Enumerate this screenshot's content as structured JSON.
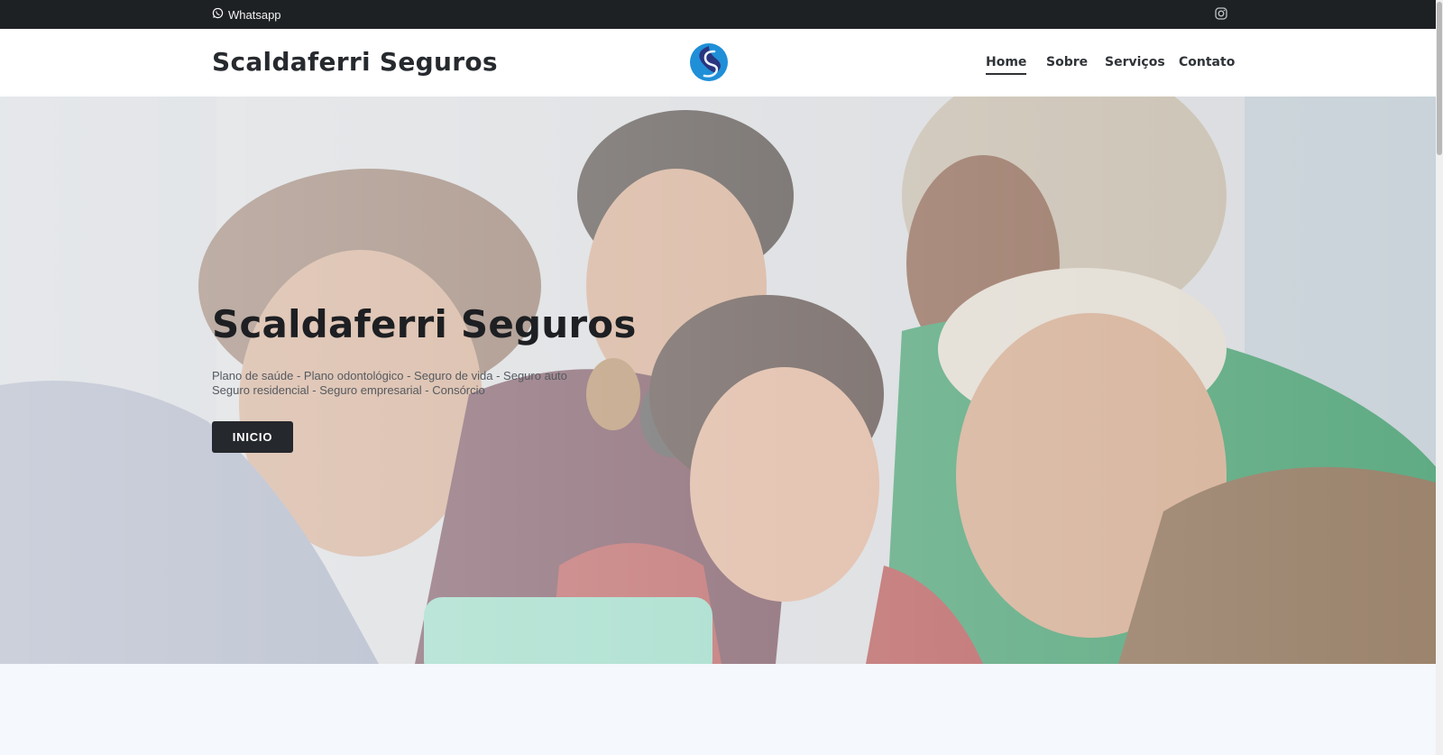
{
  "topbar": {
    "whatsapp_label": "Whatsapp",
    "whatsapp_icon": "whatsapp-icon",
    "instagram_icon": "instagram-icon"
  },
  "header": {
    "brand": "Scaldaferri Seguros",
    "logo_icon": "scaldaferri-logo",
    "nav": [
      {
        "label": "Home",
        "active": true
      },
      {
        "label": "Sobre",
        "active": false
      },
      {
        "label": "Serviços",
        "active": false
      },
      {
        "label": "Contato",
        "active": false
      }
    ]
  },
  "hero": {
    "title": "Scaldaferri Seguros",
    "subtitle_line1": "Plano de saúde - Plano odontológico - Seguro de vida - Seguro auto",
    "subtitle_line2": "Seguro residencial - Seguro empresarial - Consórcio",
    "button_label": "INICIO"
  },
  "colors": {
    "topbar_bg": "#1e2124",
    "button_bg": "#25282c",
    "logo_blue": "#1f8fd8",
    "logo_navy": "#2b2f7a"
  }
}
